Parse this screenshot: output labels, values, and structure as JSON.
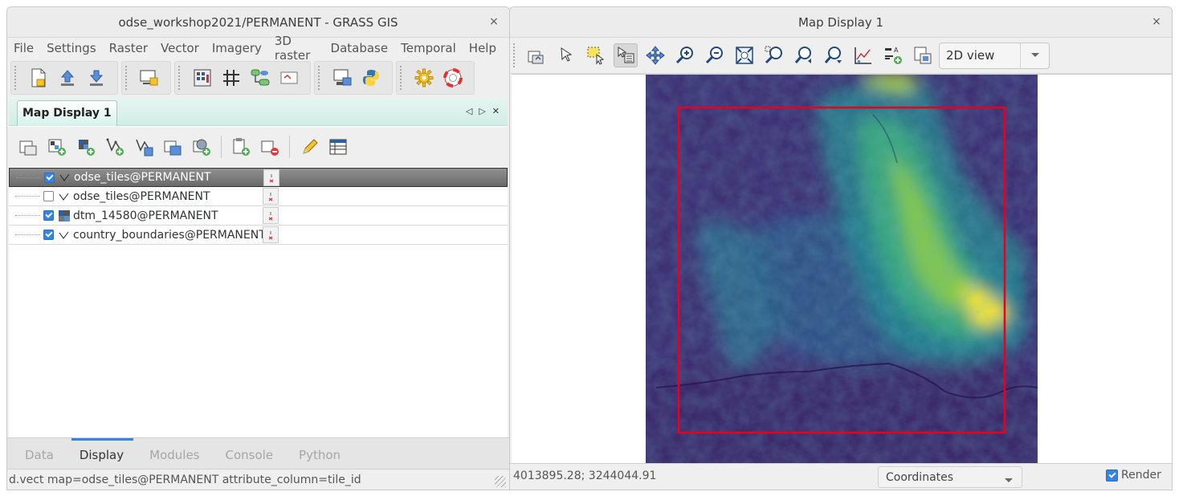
{
  "left_window": {
    "title": "odse_workshop2021/PERMANENT - GRASS GIS",
    "close": "×",
    "menu": [
      "File",
      "Settings",
      "Raster",
      "Vector",
      "Imagery",
      "3D raster",
      "Database",
      "Temporal",
      "Help"
    ],
    "dock": {
      "tab_label": "Map Display 1",
      "controls": [
        "◁",
        "▷",
        "✕"
      ]
    },
    "layers": [
      {
        "name": "odse_tiles@PERMANENT",
        "checked": true,
        "type": "vector",
        "selected": true
      },
      {
        "name": "odse_tiles@PERMANENT",
        "checked": false,
        "type": "vector",
        "selected": false
      },
      {
        "name": "dtm_14580@PERMANENT",
        "checked": true,
        "type": "raster",
        "selected": false
      },
      {
        "name": "country_boundaries@PERMANENT",
        "checked": true,
        "type": "vector",
        "selected": false
      }
    ],
    "bottom_tabs": [
      "Data",
      "Display",
      "Modules",
      "Console",
      "Python"
    ],
    "active_tab": "Display",
    "status": "d.vect map=odse_tiles@PERMANENT attribute_column=tile_id"
  },
  "right_window": {
    "title": "Map Display 1",
    "close": "×",
    "view_mode": "2D view",
    "coordinates": "4013895.28; 3244044.91",
    "status_mode": "Coordinates",
    "render_label": "Render",
    "render_checked": true
  },
  "colors": {
    "accent": "#3584e4",
    "tile_outline": "#e8001c",
    "dem_low": "#440154",
    "dem_mid": "#21918c",
    "dem_high": "#fde725"
  }
}
